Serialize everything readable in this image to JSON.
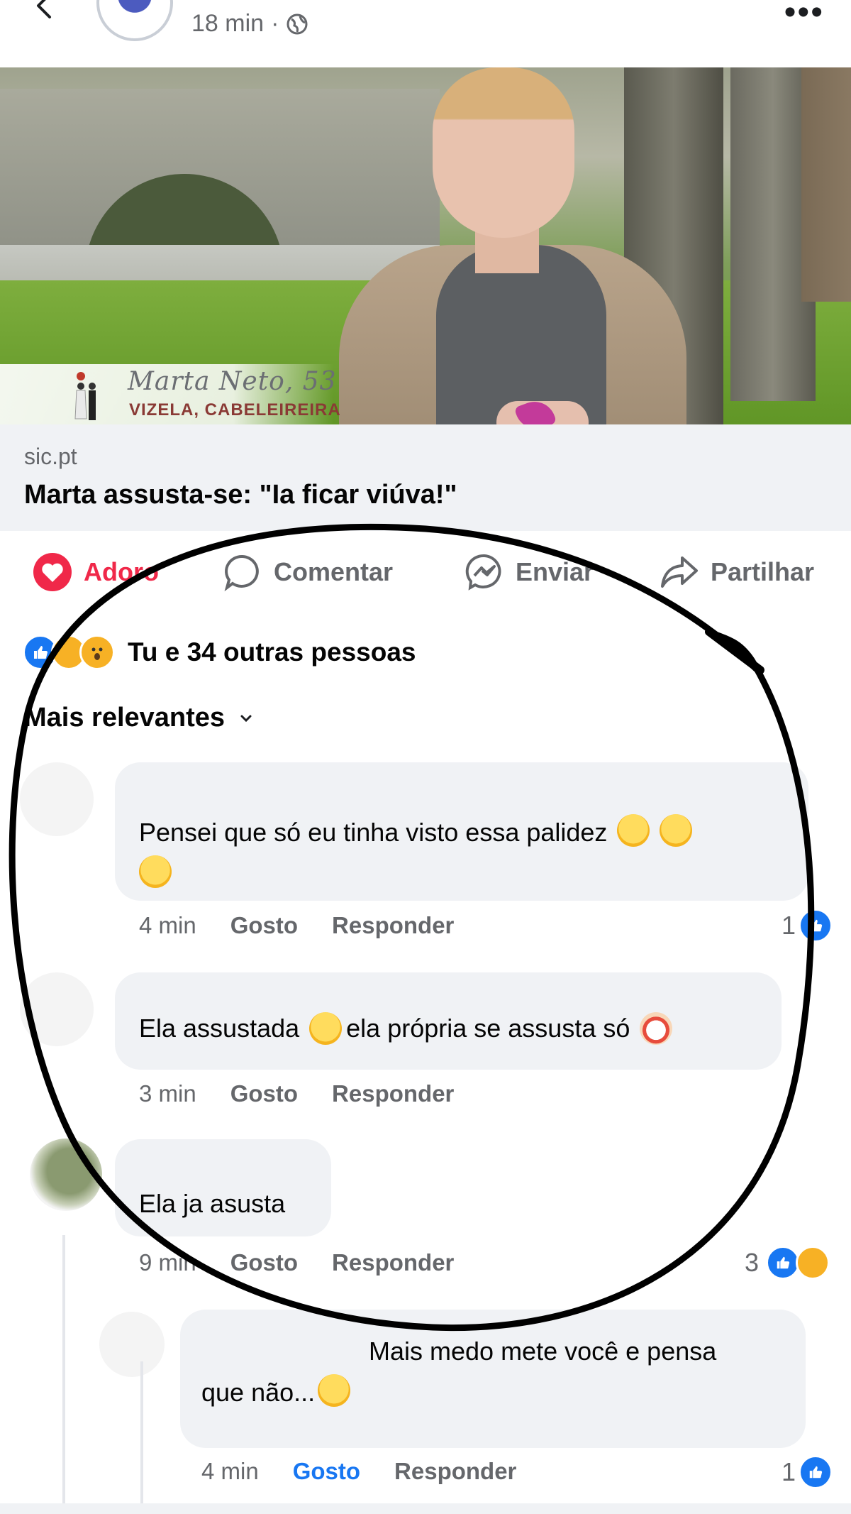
{
  "header": {
    "time": "18 min",
    "separator": "·"
  },
  "preview": {
    "overlay_name": "Marta Neto, 53",
    "overlay_sub": "VIZELA, CABELEIREIRA"
  },
  "link": {
    "domain": "sic.pt",
    "title": "Marta assusta-se: \"Ia ficar viúva!\""
  },
  "actions": {
    "like": "Adoro",
    "comment": "Comentar",
    "send": "Enviar",
    "share": "Partilhar"
  },
  "reactions": {
    "summary": "Tu e 34 outras pessoas"
  },
  "sort": {
    "label": "Mais relevantes"
  },
  "comments": [
    {
      "text": "Pensei que só eu tinha visto essa palidez",
      "time": "4 min",
      "like": "Gosto",
      "reply": "Responder",
      "count": "1"
    },
    {
      "text_a": "Ela assustada",
      "text_b": "ela própria se assusta só",
      "time": "3 min",
      "like": "Gosto",
      "reply": "Responder"
    },
    {
      "text": "Ela ja asusta",
      "time": "9 min",
      "like": "Gosto",
      "reply": "Responder",
      "count": "3"
    },
    {
      "text_a": "Mais medo mete você e pensa",
      "text_b": "que não...",
      "time": "4 min",
      "like": "Gosto",
      "reply": "Responder",
      "count": "1"
    }
  ],
  "colors": {
    "accent": "#1877f2",
    "love": "#f02849",
    "muted": "#65676b",
    "bubble": "#f0f2f5"
  }
}
